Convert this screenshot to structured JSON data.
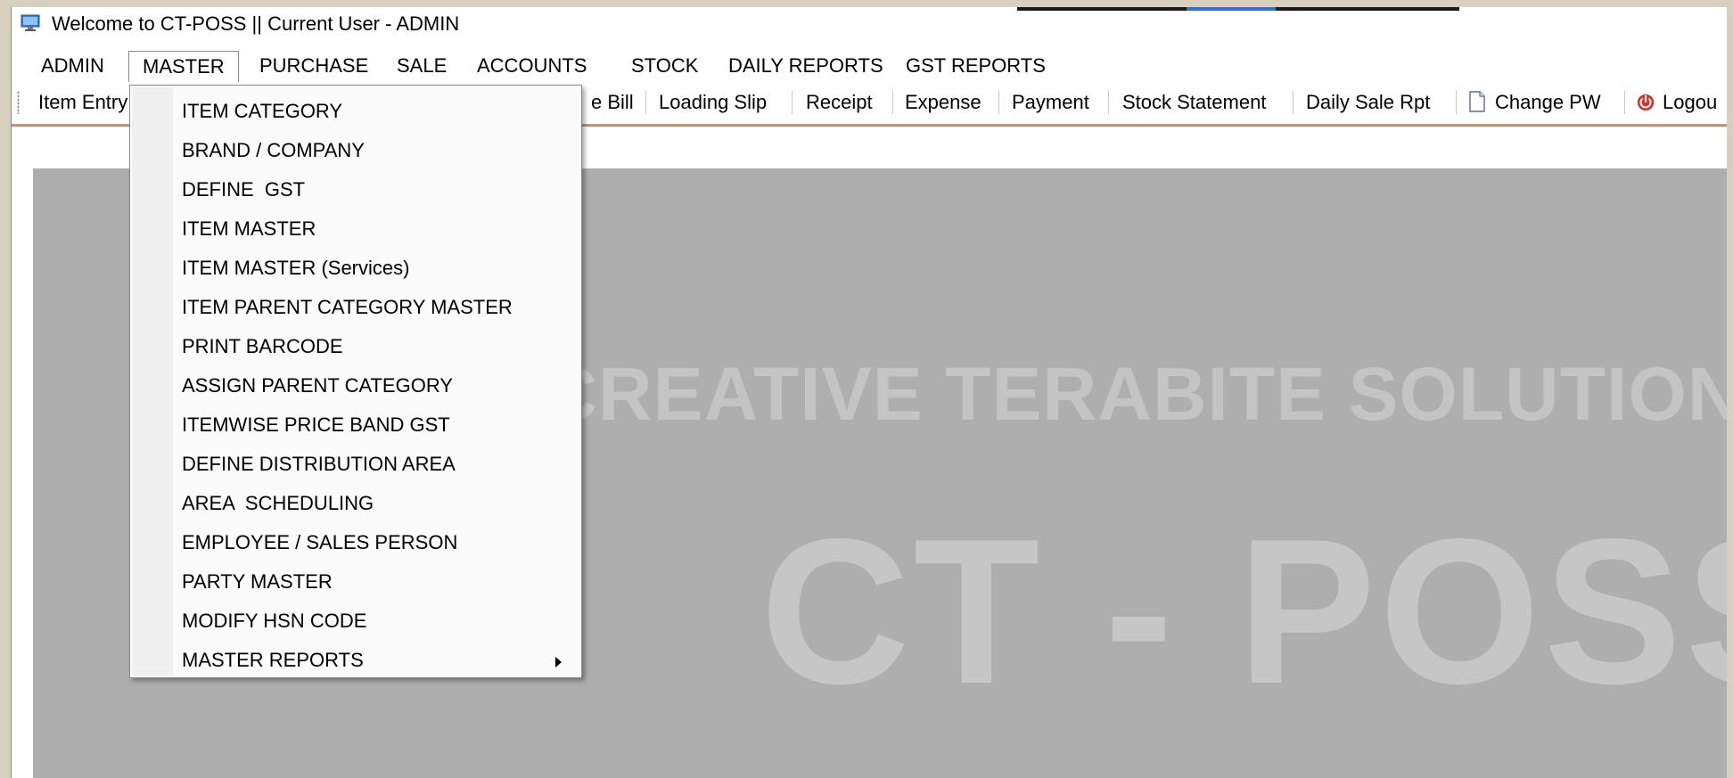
{
  "window": {
    "title": "Welcome to CT-POSS || Current User - ADMIN",
    "icon": "monitor-icon"
  },
  "menubar": {
    "items": [
      {
        "label": "ADMIN"
      },
      {
        "label": "MASTER",
        "active": true
      },
      {
        "label": "PURCHASE"
      },
      {
        "label": "SALE"
      },
      {
        "label": "ACCOUNTS"
      },
      {
        "label": "STOCK"
      },
      {
        "label": "DAILY REPORTS"
      },
      {
        "label": "GST REPORTS"
      }
    ]
  },
  "toolbar": {
    "items": [
      {
        "label": "Item Entry"
      },
      {
        "label": "e Bill"
      },
      {
        "label": "Loading Slip"
      },
      {
        "label": "Receipt"
      },
      {
        "label": "Expense"
      },
      {
        "label": "Payment"
      },
      {
        "label": "Stock Statement"
      },
      {
        "label": "Daily Sale Rpt"
      },
      {
        "label": "Change PW",
        "icon": "document-icon"
      },
      {
        "label": "Logou",
        "icon": "logout-icon"
      }
    ]
  },
  "dropdown": {
    "items": [
      {
        "label": "ITEM CATEGORY"
      },
      {
        "label": "BRAND / COMPANY"
      },
      {
        "label": "DEFINE  GST"
      },
      {
        "label": "ITEM MASTER"
      },
      {
        "label": "ITEM MASTER (Services)"
      },
      {
        "label": "ITEM PARENT CATEGORY MASTER"
      },
      {
        "label": "PRINT BARCODE"
      },
      {
        "label": "ASSIGN PARENT CATEGORY"
      },
      {
        "label": "ITEMWISE PRICE BAND GST"
      },
      {
        "label": "DEFINE DISTRIBUTION AREA"
      },
      {
        "label": "AREA  SCHEDULING"
      },
      {
        "label": "EMPLOYEE / SALES PERSON"
      },
      {
        "label": "PARTY MASTER"
      },
      {
        "label": "MODIFY HSN CODE"
      },
      {
        "label": "MASTER REPORTS",
        "submenu": true
      }
    ]
  },
  "content": {
    "watermark_line1": "ME CREATIVE TERABITE SOLUTION",
    "watermark_line2": "CT - POSS"
  },
  "colors": {
    "accent_line": "#d08448",
    "content_bg": "#aeaeae",
    "watermark": "#c6c6c6"
  }
}
